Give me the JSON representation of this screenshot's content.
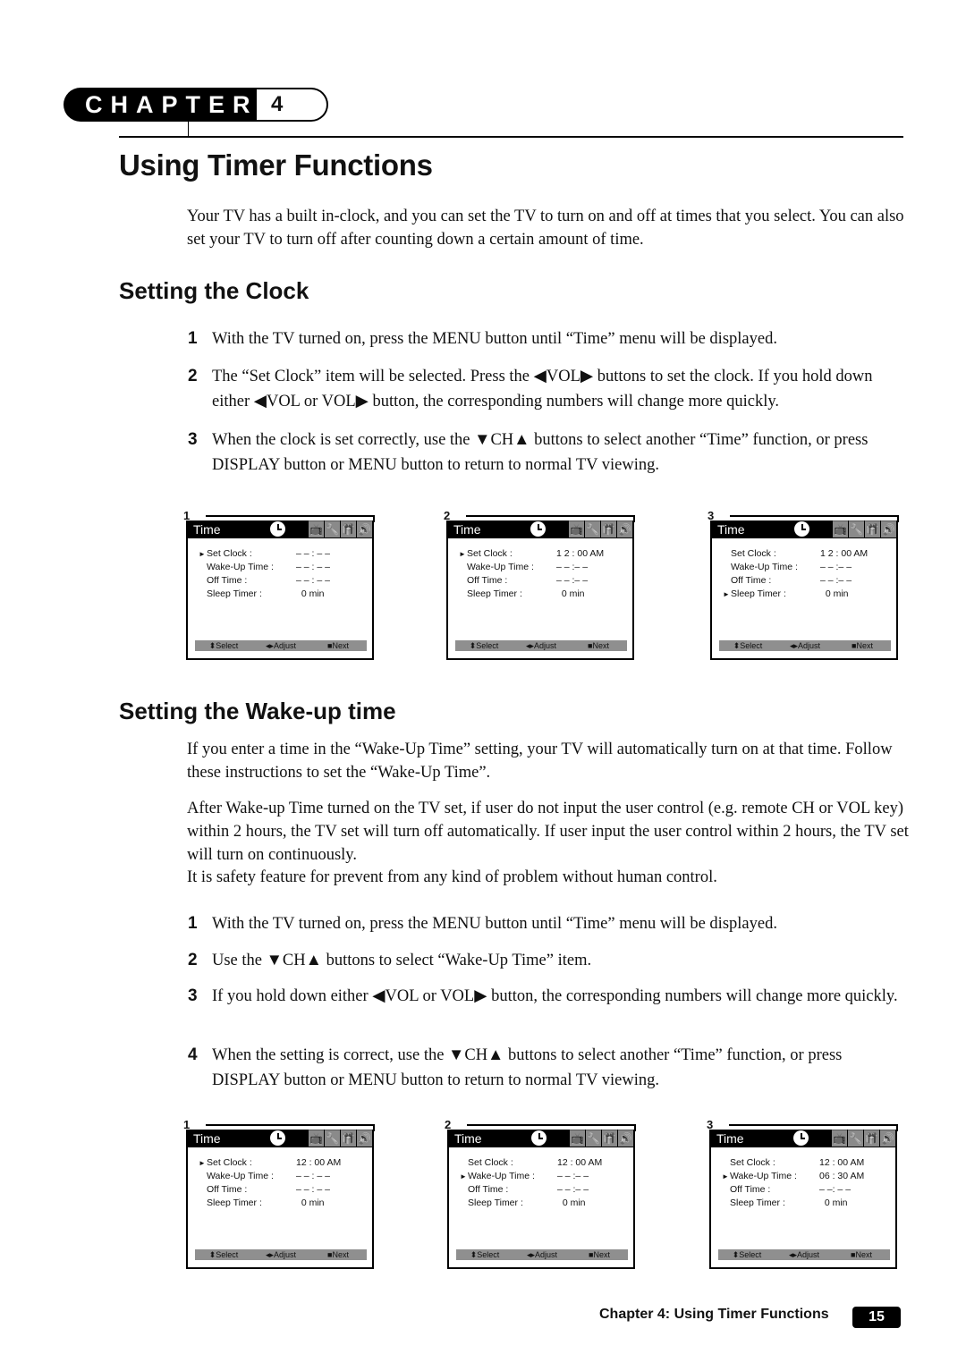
{
  "chapter": {
    "label": "CHAPTER",
    "number": "4"
  },
  "title": "Using Timer Functions",
  "intro": "Your TV has a built in-clock, and you can set the TV to turn on and off at times that you select. You can also set your TV to turn off after counting down a certain amount of time.",
  "sections": [
    {
      "heading": "Setting the Clock",
      "steps": [
        {
          "num": "1",
          "text": "With the TV turned on, press the MENU button until “Time” menu will be displayed."
        },
        {
          "num": "2",
          "text": "The “Set Clock” item will be selected. Press the ◀VOL▶ buttons to set the clock. If you hold down either ◀VOL or VOL▶ button, the corresponding numbers will change more quickly."
        },
        {
          "num": "3",
          "text": "When the clock is set correctly, use the ▼CH▲ buttons to select another “Time” function, or press DISPLAY button or MENU button to return to normal TV viewing."
        }
      ],
      "screens": [
        {
          "num": "1",
          "rows": [
            {
              "ptr": "►",
              "label": "Set Clock :",
              "value": "– – : – –"
            },
            {
              "ptr": "",
              "label": "Wake-Up Time :",
              "value": "– – : – –"
            },
            {
              "ptr": "",
              "label": "Off Time :",
              "value": "– – : – –"
            },
            {
              "ptr": "",
              "label": "Sleep Timer :",
              "value": "  0 min"
            }
          ]
        },
        {
          "num": "2",
          "rows": [
            {
              "ptr": "►",
              "label": "Set Clock :",
              "value": "1 2 : 00 AM"
            },
            {
              "ptr": "",
              "label": "Wake-Up Time :",
              "value": "– – :– –"
            },
            {
              "ptr": "",
              "label": "Off Time :",
              "value": "– – :– –"
            },
            {
              "ptr": "",
              "label": "Sleep Timer :",
              "value": "  0 min"
            }
          ]
        },
        {
          "num": "3",
          "rows": [
            {
              "ptr": "",
              "label": "Set Clock :",
              "value": "1 2 : 00 AM"
            },
            {
              "ptr": "",
              "label": "Wake-Up Time :",
              "value": "– – :– –"
            },
            {
              "ptr": "",
              "label": "Off Time :",
              "value": "– – :– –"
            },
            {
              "ptr": "►",
              "label": "Sleep Timer :",
              "value": "  0 min"
            }
          ]
        }
      ]
    },
    {
      "heading": "Setting the Wake-up time",
      "paragraphs": [
        "If you enter a time in the “Wake-Up Time” setting, your TV will automatically turn on at that time. Follow these instructions to set the “Wake-Up Time”.",
        "After Wake-up Time turned on the TV set, if user do not input the user control (e.g. remote CH or VOL key) within 2 hours, the TV set will turn off automatically. If user input the user control within 2 hours, the TV set will turn on continuously.",
        "It is safety feature for prevent from any kind of problem without human control."
      ],
      "steps": [
        {
          "num": "1",
          "text": "With the TV turned on, press the MENU button until “Time” menu will be displayed."
        },
        {
          "num": "2",
          "text": "Use the ▼CH▲ buttons to select “Wake-Up Time” item."
        },
        {
          "num": "3",
          "text": "If you hold down either ◀VOL or VOL▶ button, the corresponding numbers will change more quickly."
        },
        {
          "num": "4",
          "text": "When the setting is correct, use the ▼CH▲ buttons to select another “Time” function, or press DISPLAY button or MENU button to return to normal TV viewing."
        }
      ],
      "screens": [
        {
          "num": "1",
          "rows": [
            {
              "ptr": "►",
              "label": "Set Clock :",
              "value": "12 : 00 AM"
            },
            {
              "ptr": "",
              "label": "Wake-Up Time :",
              "value": "– – : – –"
            },
            {
              "ptr": "",
              "label": "Off Time :",
              "value": "– – : – –"
            },
            {
              "ptr": "",
              "label": "Sleep Timer :",
              "value": "  0 min"
            }
          ]
        },
        {
          "num": "2",
          "rows": [
            {
              "ptr": "",
              "label": "Set Clock :",
              "value": "12 : 00 AM"
            },
            {
              "ptr": "►",
              "label": "Wake-Up Time :",
              "value": "– – :– –"
            },
            {
              "ptr": "",
              "label": "Off Time :",
              "value": "– – :– –"
            },
            {
              "ptr": "",
              "label": "Sleep Timer :",
              "value": "  0 min"
            }
          ]
        },
        {
          "num": "3",
          "rows": [
            {
              "ptr": "",
              "label": "Set Clock :",
              "value": "12 : 00 AM"
            },
            {
              "ptr": "►",
              "label": "Wake-Up Time :",
              "value": "06 : 30 AM"
            },
            {
              "ptr": "",
              "label": "Off Time :",
              "value": "– –: – –"
            },
            {
              "ptr": "",
              "label": "Sleep Timer :",
              "value": "  0 min"
            }
          ]
        }
      ]
    }
  ],
  "osd": {
    "title": "Time",
    "tab_icons": [
      "tv-icon",
      "wrench-icon",
      "gift-icon",
      "speaker-icon"
    ],
    "tab_glyphs": [
      "📺",
      "🔧",
      "🎁",
      "🔊"
    ],
    "footer": {
      "select": "⬍Select",
      "adjust": "◂▸Adjust",
      "next": "■Next"
    }
  },
  "footer": {
    "text": "Chapter 4: Using Timer Functions",
    "page": "15"
  }
}
